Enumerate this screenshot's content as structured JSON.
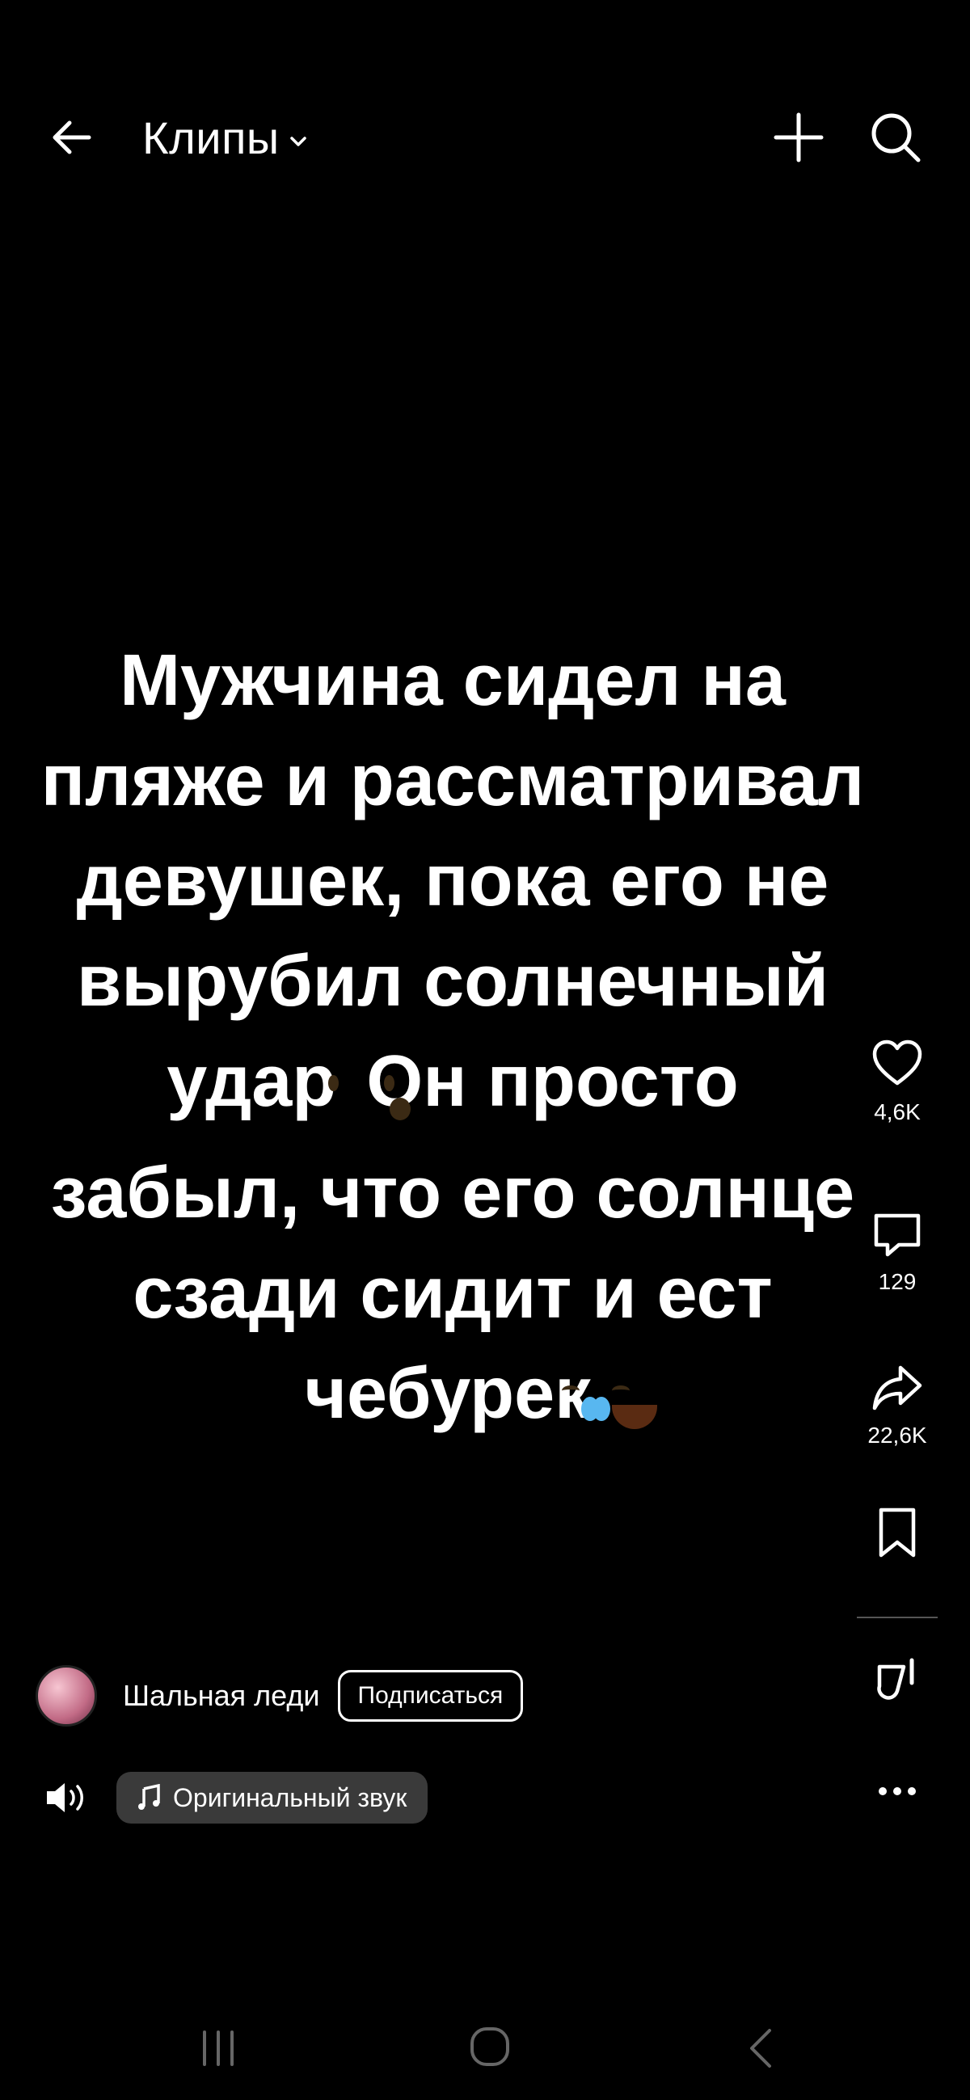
{
  "header": {
    "title": "Клипы",
    "icons": {
      "back": "arrow-left-icon",
      "dropdown": "chevron-down-icon",
      "add": "plus-icon",
      "search": "search-icon"
    }
  },
  "caption": {
    "line1": "Мужчина сидел на",
    "line2": "пляже и рассматривал",
    "line3": "девушек, пока его не",
    "line4": "вырубил солнечный",
    "line5a": "удар",
    "line5b": "Он просто",
    "line6": "забыл, что его солнце",
    "line7": "сзади сидит и ест",
    "line8": "чебурек",
    "emojis": [
      "surprised-face-icon",
      "tears-of-joy-icon"
    ]
  },
  "actions": {
    "like_count": "4,6K",
    "comment_count": "129",
    "share_count": "22,6K",
    "icons": [
      "heart-icon",
      "comment-icon",
      "share-icon",
      "bookmark-icon",
      "remix-icon",
      "more-icon"
    ]
  },
  "author": {
    "name": "Шальная леди",
    "follow_label": "Подписаться"
  },
  "audio": {
    "label": "Оригинальный звук",
    "icons": [
      "speaker-icon",
      "music-note-icon"
    ]
  },
  "navbar": {
    "icons": [
      "recents-icon",
      "home-icon",
      "nav-back-icon"
    ]
  },
  "colors": {
    "background": "#000000",
    "text": "#ffffff",
    "pill": "#3a3a3a"
  }
}
